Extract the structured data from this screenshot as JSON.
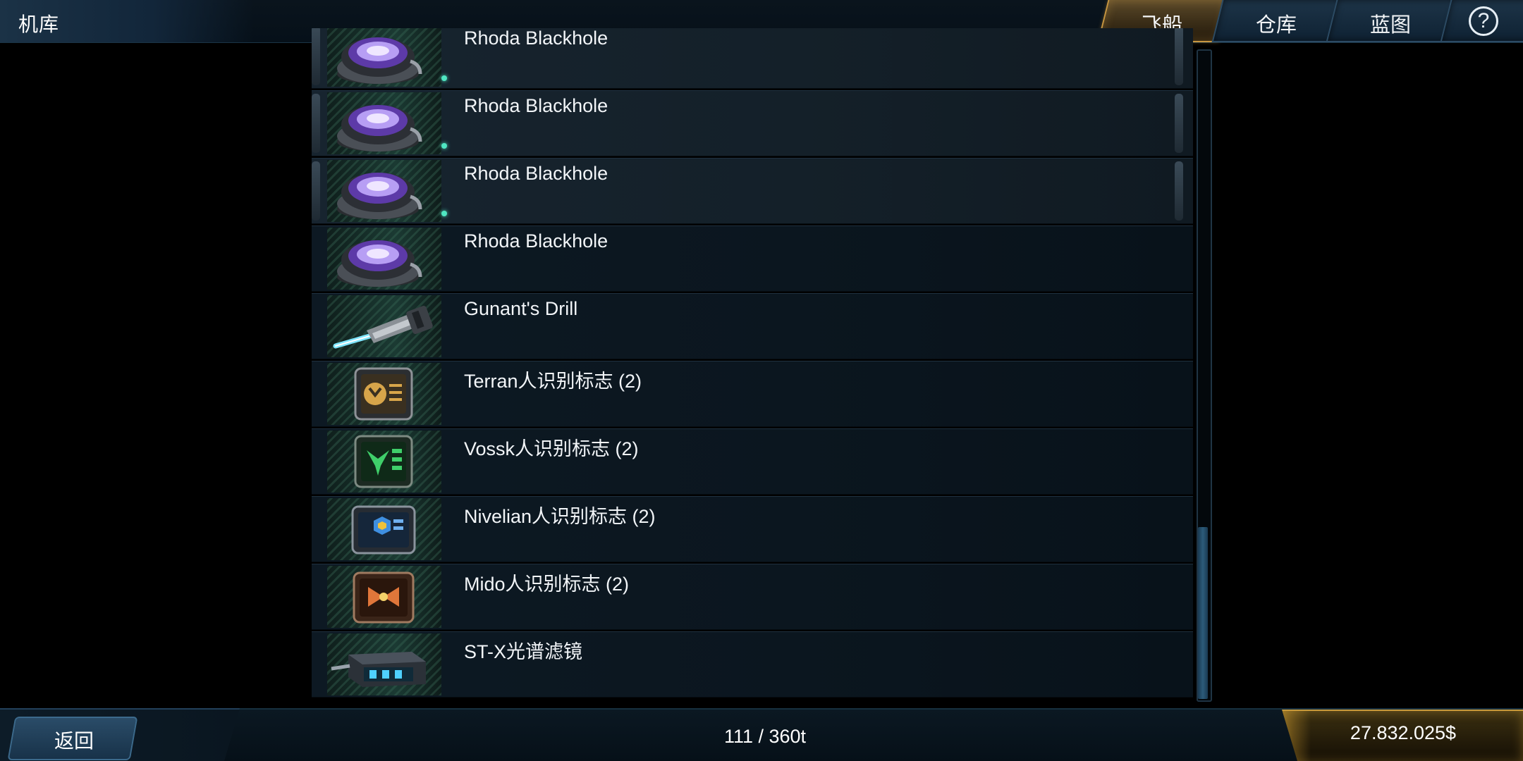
{
  "header": {
    "title": "机库",
    "tabs": [
      {
        "label": "飞船",
        "active": true
      },
      {
        "label": "仓库",
        "active": false
      },
      {
        "label": "蓝图",
        "active": false
      }
    ],
    "help_label": "?"
  },
  "items": [
    {
      "name": "Rhoda Blackhole",
      "icon": "blackhole-generator-icon",
      "selected": true,
      "equipped": true
    },
    {
      "name": "Rhoda Blackhole",
      "icon": "blackhole-generator-icon",
      "selected": true,
      "equipped": true
    },
    {
      "name": "Rhoda Blackhole",
      "icon": "blackhole-generator-icon",
      "selected": true,
      "equipped": true
    },
    {
      "name": "Rhoda Blackhole",
      "icon": "blackhole-generator-icon",
      "selected": false,
      "equipped": false
    },
    {
      "name": "Gunant's Drill",
      "icon": "drill-icon",
      "selected": false,
      "equipped": false
    },
    {
      "name": "Terran人识别标志 (2)",
      "icon": "terran-id-card-icon",
      "selected": false,
      "equipped": false,
      "color": "#d7a54a"
    },
    {
      "name": "Vossk人识别标志 (2)",
      "icon": "vossk-id-card-icon",
      "selected": false,
      "equipped": false,
      "color": "#3fcf6a"
    },
    {
      "name": "Nivelian人识别标志 (2)",
      "icon": "nivelian-id-card-icon",
      "selected": false,
      "equipped": false,
      "color": "#3f8fe0"
    },
    {
      "name": "Mido人识别标志 (2)",
      "icon": "mido-id-card-icon",
      "selected": false,
      "equipped": false,
      "color": "#e0763a"
    },
    {
      "name": "ST-X光谱滤镜",
      "icon": "spectral-filter-icon",
      "selected": false,
      "equipped": false
    }
  ],
  "footer": {
    "back_label": "返回",
    "capacity": "111 / 360t",
    "money": "27.832.025$"
  }
}
